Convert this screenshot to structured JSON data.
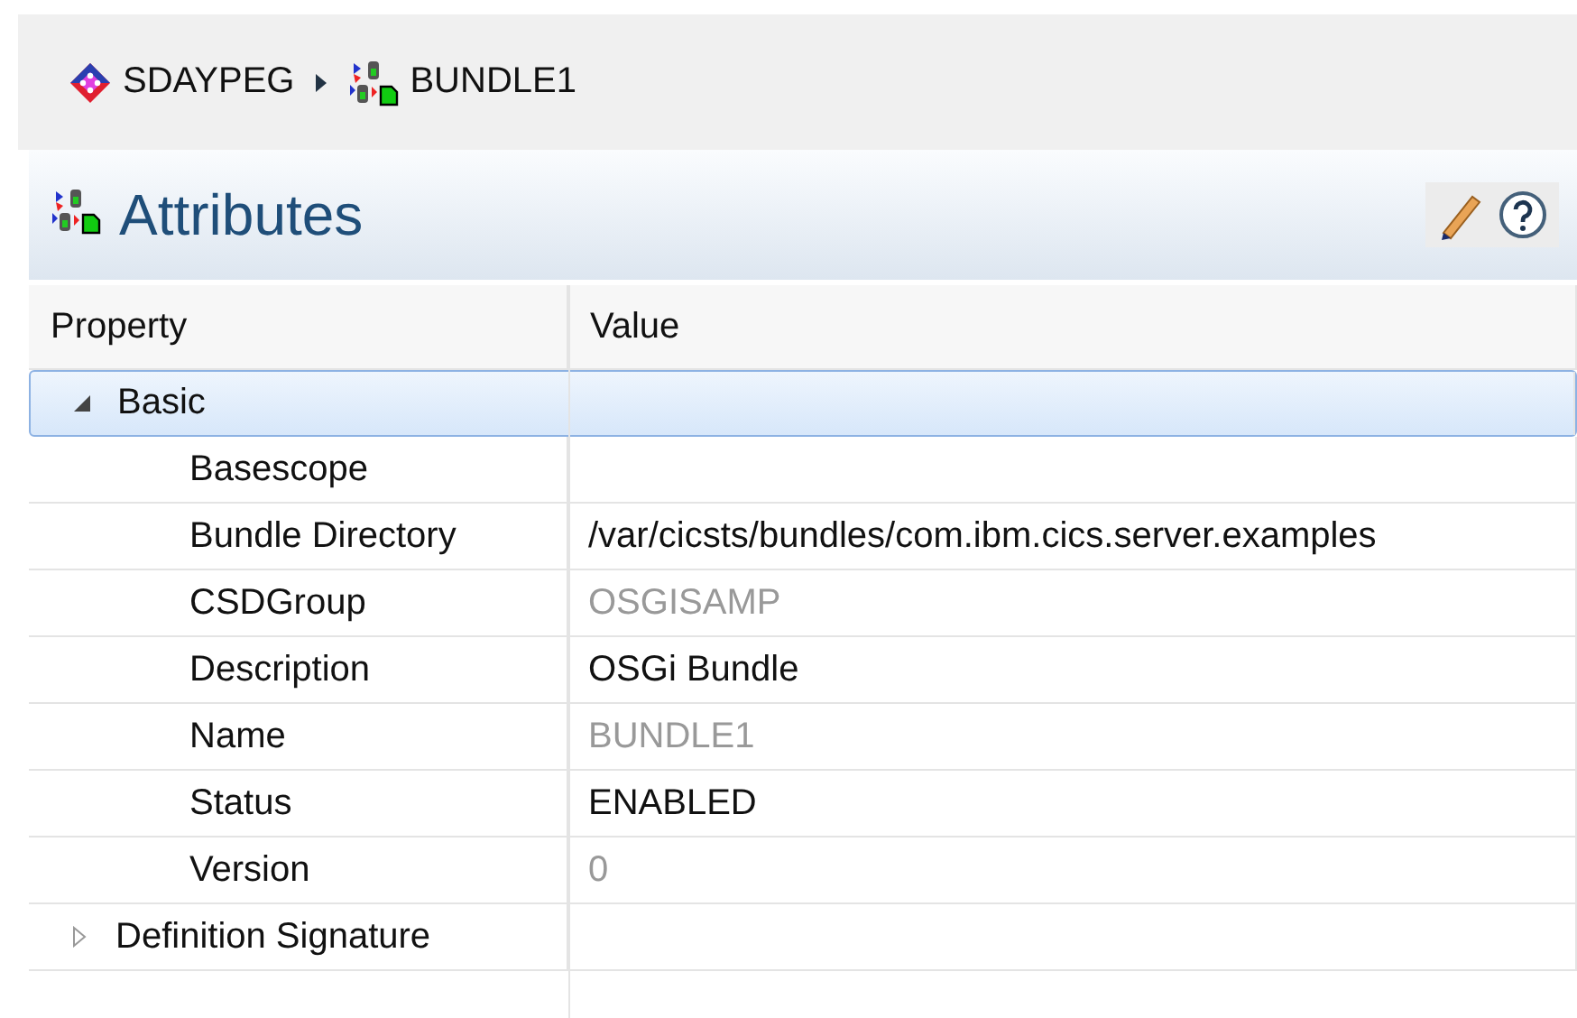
{
  "breadcrumb": [
    {
      "label": "SDAYPEG",
      "kind": "region"
    },
    {
      "label": "BUNDLE1",
      "kind": "bundle"
    }
  ],
  "section": {
    "title": "Attributes",
    "kind": "bundle"
  },
  "table": {
    "columns": [
      "Property",
      "Value"
    ],
    "rows": [
      {
        "property": "Basic",
        "expanded": true,
        "selected": true,
        "children": [
          {
            "property": "Basescope",
            "selected": false
          },
          {
            "property": "Bundle Directory",
            "value": "/var/cicsts/bundles/com.ibm.cics.server.examples",
            "selected": false,
            "editable": true
          },
          {
            "property": "CSDGroup",
            "value": "OSGISAMP",
            "selected": false,
            "editable": false
          },
          {
            "property": "Description",
            "value": "OSGi Bundle",
            "selected": false,
            "editable": true
          },
          {
            "property": "Name",
            "value": "BUNDLE1",
            "selected": false,
            "editable": false
          },
          {
            "property": "Status",
            "value": "ENABLED",
            "selected": false,
            "editable": true
          },
          {
            "property": "Version",
            "value": "0",
            "selected": false,
            "editable": false
          }
        ]
      },
      {
        "property": "Definition Signature",
        "expanded": false,
        "selected": false
      }
    ]
  }
}
